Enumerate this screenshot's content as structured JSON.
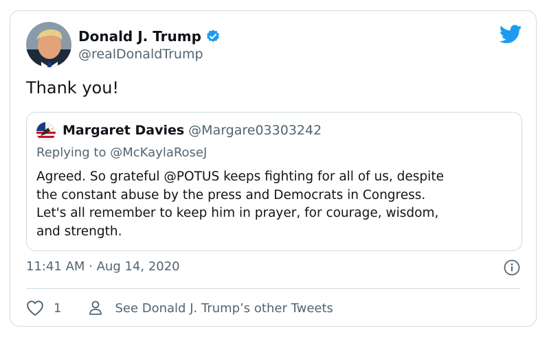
{
  "tweet": {
    "author_name": "Donald J. Trump",
    "author_handle": "@realDonaldTrump",
    "text": "Thank you!",
    "timestamp": "11:41 AM · Aug 14, 2020",
    "like_count": "1",
    "other_tweets_label": "See Donald J. Trump’s other Tweets"
  },
  "quoted_tweet": {
    "author_name": "Margaret Davies",
    "author_handle": "@Margare03303242",
    "replying_to_prefix": "Replying to",
    "replying_to_handle": "@McKaylaRoseJ",
    "body_lines": [
      "Agreed. So grateful @POTUS keeps fighting for all of us, despite",
      "the constant abuse by the press and Democrats in Congress.",
      "Let's all remember to keep him in prayer, for courage, wisdom,",
      "and strength."
    ]
  },
  "icons": {
    "verified": "verified-badge-icon",
    "brand": "twitter-bird-icon",
    "info": "info-icon",
    "like": "heart-icon",
    "profile": "person-icon"
  },
  "colors": {
    "brand_blue": "#1d9bf0",
    "text_primary": "#0f1419",
    "text_secondary": "#536471",
    "border": "#cfd9de"
  }
}
